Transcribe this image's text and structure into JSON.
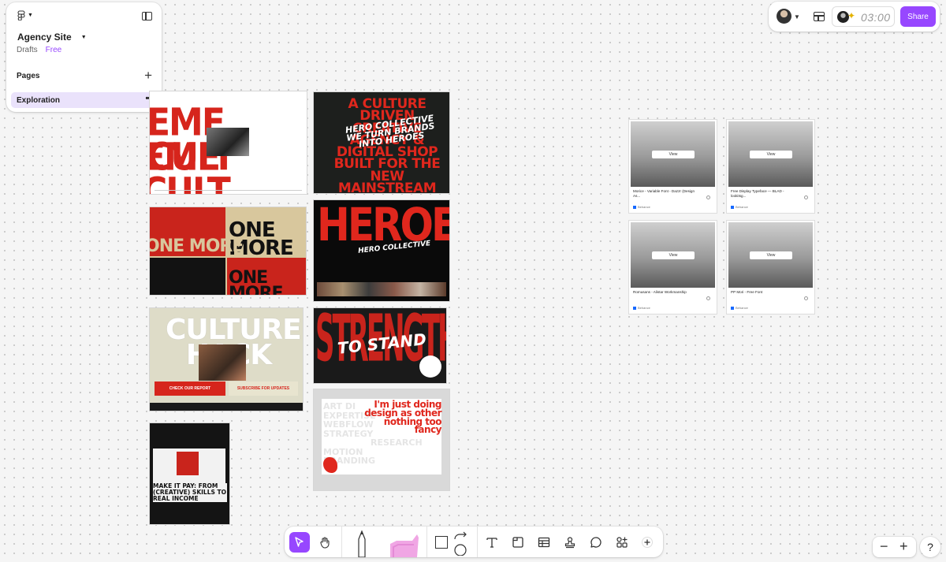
{
  "file": {
    "name": "Agency Site",
    "location": "Drafts",
    "plan": "Free"
  },
  "pages": {
    "heading": "Pages",
    "items": [
      {
        "label": "Exploration",
        "active": true
      }
    ]
  },
  "header": {
    "timer": "03:00",
    "share_label": "Share"
  },
  "frames": {
    "culture_driven": {
      "headline": "A CULTURE DRIVEN CREATIVE AGENCY & DIGITAL SHOP BUILT FOR THE NEW MAINSTREAM",
      "script": "HERO COLLECTIVE WE TURN BRANDS INTO HEROES"
    },
    "heroes": {
      "headline": "HEROES",
      "script": "HERO COLLECTIVE"
    },
    "culture_hack": {
      "headline": "CULTURE HACK",
      "cta_primary": "CHECK OUR REPORT",
      "cta_secondary": "SUBSCRIBE FOR UPDATES"
    },
    "strength": {
      "headline": "STRENGTH",
      "script": "TO STAND"
    },
    "design_other": {
      "headline": "I'm just doing design as other nothing too fancy",
      "list": [
        "ART DI",
        "EXPERTISE",
        "WEBFLOW",
        "STRATEGY",
        "RESEARCH",
        "MOTION",
        "BRANDING"
      ]
    },
    "make_it_pay": {
      "headline": "MAKE IT PAY: FROM (CREATIVE) SKILLS TO REAL INCOME"
    },
    "one_more": {
      "headline": "ONE MORE"
    },
    "extreme_culture": {
      "headline": "EME CULT"
    }
  },
  "behance_cards": [
    {
      "title": "Morice - Variable Font - Dazzr (Design As...",
      "source": "Behance",
      "view": "View"
    },
    {
      "title": "Free Display Typeface — BLAD - lookitsg...",
      "source": "Behance",
      "view": "View"
    },
    {
      "title": "Romusans - Alistar Workmanship",
      "source": "Behance",
      "view": "View"
    },
    {
      "title": "PP Mori - Free Font",
      "source": "Behance",
      "view": "View"
    }
  ],
  "toolbar": {
    "tools": [
      "move-tool",
      "hand-tool",
      "pen-tool",
      "marker-tool",
      "shape-tool",
      "connector-tool",
      "text-tool",
      "section-tool",
      "table-tool",
      "stamp-tool",
      "comment-tool",
      "widgets-tool",
      "more-tool"
    ],
    "active": "move-tool"
  },
  "zoom": {
    "out": "−",
    "in": "+"
  },
  "help": "?",
  "colors": {
    "accent": "#9747ff",
    "poster_red": "#d6251c"
  }
}
